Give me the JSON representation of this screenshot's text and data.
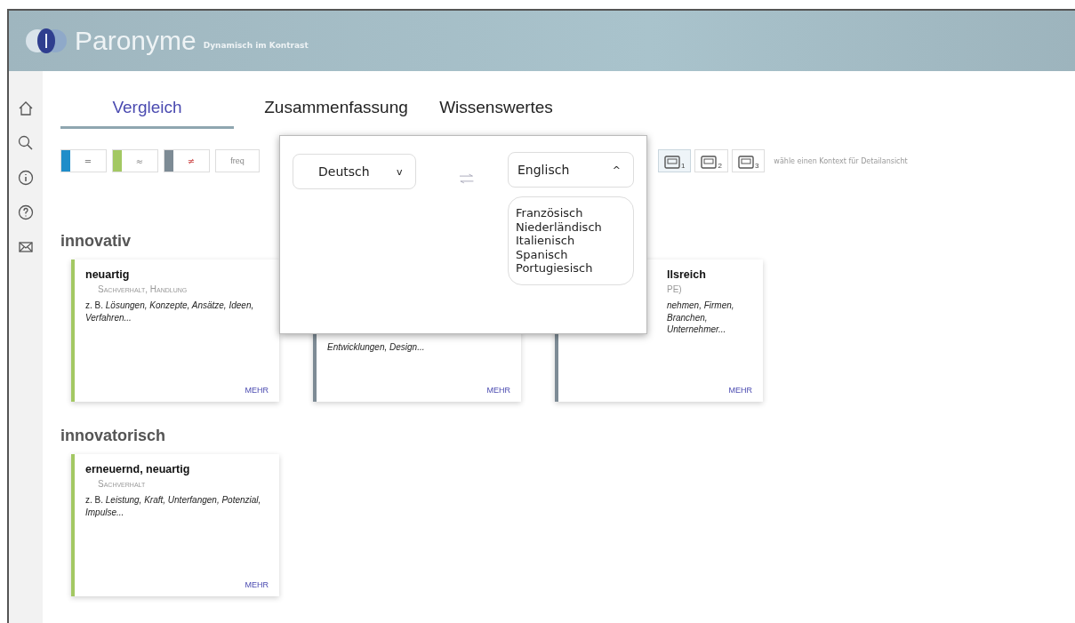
{
  "header": {
    "title": "Paronyme",
    "subtitle": "Dynamisch im Kontrast"
  },
  "sidebar": {
    "items": [
      {
        "kind": "home"
      },
      {
        "kind": "search"
      },
      {
        "kind": "info"
      },
      {
        "kind": "help"
      },
      {
        "kind": "mail"
      }
    ]
  },
  "tabs": [
    {
      "label": "Vergleich",
      "selected": true
    },
    {
      "label": "Zusammenfassung",
      "selected": false
    },
    {
      "label": "Wissenswertes",
      "selected": false
    }
  ],
  "legend": [
    {
      "symbol": "=",
      "color": "#1f8dc9"
    },
    {
      "symbol": "≈",
      "color": "#a3c863"
    },
    {
      "symbol": "≠",
      "color": "#7d8b95"
    }
  ],
  "freq": "freq",
  "contexts": [
    {
      "number": "1",
      "selected": true
    },
    {
      "number": "2",
      "selected": false
    },
    {
      "number": "3",
      "selected": false
    }
  ],
  "context_hint": "wähle einen Kontext für Detailansicht",
  "language_popup": {
    "source": "Deutsch",
    "source_caret": "v",
    "target": "Englisch",
    "target_caret": "^",
    "options": [
      "Französisch",
      "Niederländisch",
      "Italienisch",
      "Spanisch",
      "Portugiesisch"
    ]
  },
  "groups": [
    {
      "heading": "innovativ",
      "cards": [
        {
          "title": "neuartig",
          "category": "Sachverhalt, Handlung",
          "example_prefix": "z. B.",
          "example": "Lösungen, Konzepte, Ansätze, Ideen, Verfahren...",
          "more": "MEHR",
          "color": "#a3c863"
        },
        {
          "example": "Entwicklungen, Design...",
          "more": "MEHR",
          "color": "#7d8b95"
        },
        {
          "title": "llsreich",
          "category": "PE)",
          "example": "nehmen, Firmen,\nBranchen, Unternehmer...",
          "more": "MEHR",
          "color": "#7d8b95"
        }
      ]
    },
    {
      "heading": "innovatorisch",
      "cards": [
        {
          "title": "erneuernd, neuartig",
          "category": "Sachverhalt",
          "example_prefix": "z. B.",
          "example": "Leistung, Kraft, Unterfangen, Potenzial, Impulse...",
          "more": "MEHR",
          "color": "#a3c863"
        }
      ]
    }
  ]
}
